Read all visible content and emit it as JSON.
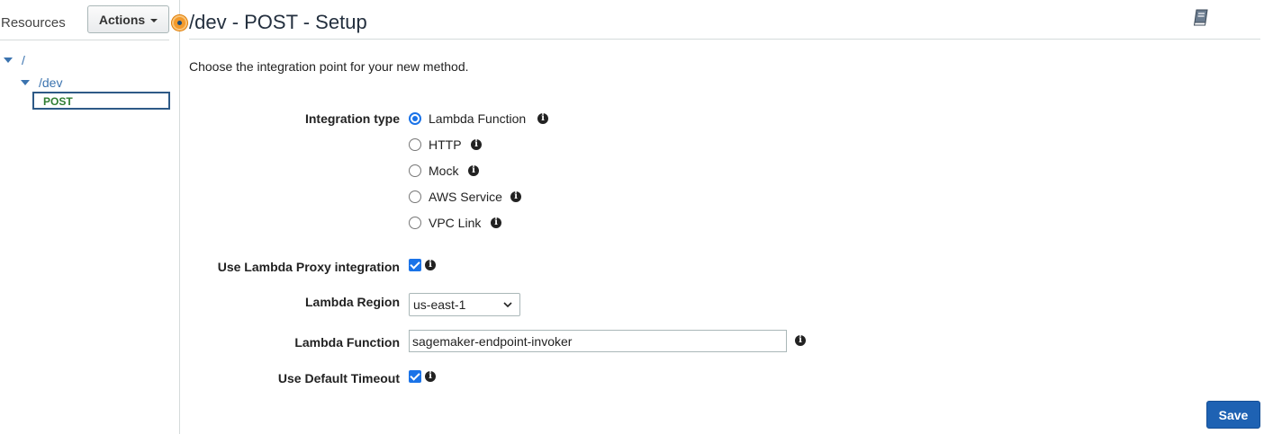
{
  "sidebar": {
    "title": "Resources",
    "actions_label": "Actions",
    "tree": {
      "root": "/",
      "dev": "/dev",
      "method": "POST"
    }
  },
  "header": {
    "title": "/dev - POST - Setup",
    "book_icon": "book-icon"
  },
  "intro": "Choose the integration point for your new method.",
  "integration": {
    "label": "Integration type",
    "options": [
      {
        "label": "Lambda Function",
        "selected": true
      },
      {
        "label": "HTTP",
        "selected": false
      },
      {
        "label": "Mock",
        "selected": false
      },
      {
        "label": "AWS Service",
        "selected": false
      },
      {
        "label": "VPC Link",
        "selected": false
      }
    ]
  },
  "proxy": {
    "label": "Use Lambda Proxy integration",
    "checked": true
  },
  "region": {
    "label": "Lambda Region",
    "value": "us-east-1"
  },
  "function": {
    "label": "Lambda Function",
    "value": "sagemaker-endpoint-invoker"
  },
  "timeout": {
    "label": "Use Default Timeout",
    "checked": true
  },
  "save_label": "Save",
  "colors": {
    "accent": "#1e62b3",
    "link": "#3b73af",
    "method": "#2f7d32",
    "status_dot": "#f39a2b"
  }
}
